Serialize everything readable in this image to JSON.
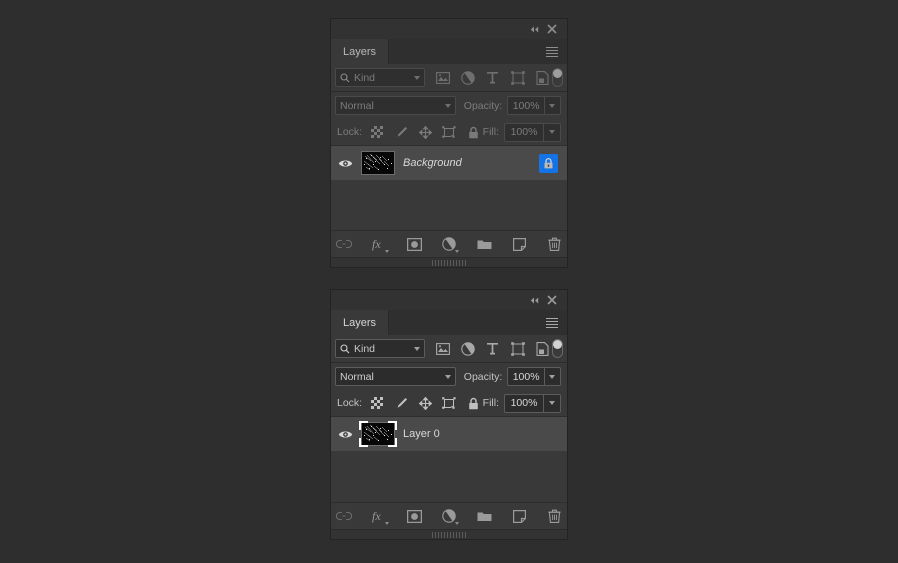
{
  "app": {
    "background_color": "#2e2e2e",
    "accent_color": "#1473e6",
    "panel_color": "#393939"
  },
  "panels": [
    {
      "id": "layers-panel-top",
      "state": "inactive",
      "titlebar": {
        "collapse_label": "«",
        "close_label": "✕"
      },
      "tab": {
        "label": "Layers"
      },
      "filter": {
        "kind_label": "Kind",
        "icons": [
          "pixel-layer-filter-icon",
          "adjustment-layer-filter-icon",
          "type-layer-filter-icon",
          "shape-layer-filter-icon",
          "smart-object-filter-icon"
        ],
        "toggle_name": "filter-enable-toggle"
      },
      "blend": {
        "mode": "Normal",
        "opacity_label": "Opacity:",
        "opacity_value": "100%"
      },
      "lock": {
        "label": "Lock:",
        "icons": [
          "lock-transparent-pixels-icon",
          "lock-image-pixels-icon",
          "lock-position-icon",
          "lock-artboard-nesting-icon",
          "lock-all-icon"
        ],
        "fill_label": "Fill:",
        "fill_value": "100%"
      },
      "layers": [
        {
          "name": "Background",
          "italic": true,
          "visible": true,
          "selected": true,
          "locked": true,
          "thumbnail_selected": false
        }
      ],
      "toolbar": [
        {
          "name": "link-layers-icon",
          "label": "link",
          "dim": true
        },
        {
          "name": "layer-styles-fx-icon",
          "label": "fx",
          "dim": false
        },
        {
          "name": "add-layer-mask-icon",
          "label": "mask",
          "dim": false
        },
        {
          "name": "new-adjustment-layer-icon",
          "label": "adjustment",
          "dim": false
        },
        {
          "name": "new-group-icon",
          "label": "group",
          "dim": false
        },
        {
          "name": "new-layer-icon",
          "label": "new-layer",
          "dim": false
        },
        {
          "name": "delete-layer-icon",
          "label": "delete",
          "dim": false
        }
      ]
    },
    {
      "id": "layers-panel-bottom",
      "state": "active",
      "titlebar": {
        "collapse_label": "«",
        "close_label": "✕"
      },
      "tab": {
        "label": "Layers"
      },
      "filter": {
        "kind_label": "Kind",
        "icons": [
          "pixel-layer-filter-icon",
          "adjustment-layer-filter-icon",
          "type-layer-filter-icon",
          "shape-layer-filter-icon",
          "smart-object-filter-icon"
        ],
        "toggle_name": "filter-enable-toggle"
      },
      "blend": {
        "mode": "Normal",
        "opacity_label": "Opacity:",
        "opacity_value": "100%"
      },
      "lock": {
        "label": "Lock:",
        "icons": [
          "lock-transparent-pixels-icon",
          "lock-image-pixels-icon",
          "lock-position-icon",
          "lock-artboard-nesting-icon",
          "lock-all-icon"
        ],
        "fill_label": "Fill:",
        "fill_value": "100%"
      },
      "layers": [
        {
          "name": "Layer 0",
          "italic": false,
          "visible": true,
          "selected": true,
          "locked": false,
          "thumbnail_selected": true
        }
      ],
      "toolbar": [
        {
          "name": "link-layers-icon",
          "label": "link",
          "dim": true
        },
        {
          "name": "layer-styles-fx-icon",
          "label": "fx",
          "dim": false
        },
        {
          "name": "add-layer-mask-icon",
          "label": "mask",
          "dim": false
        },
        {
          "name": "new-adjustment-layer-icon",
          "label": "adjustment",
          "dim": false
        },
        {
          "name": "new-group-icon",
          "label": "group",
          "dim": false
        },
        {
          "name": "new-layer-icon",
          "label": "new-layer",
          "dim": false
        },
        {
          "name": "delete-layer-icon",
          "label": "delete",
          "dim": false
        }
      ]
    }
  ]
}
